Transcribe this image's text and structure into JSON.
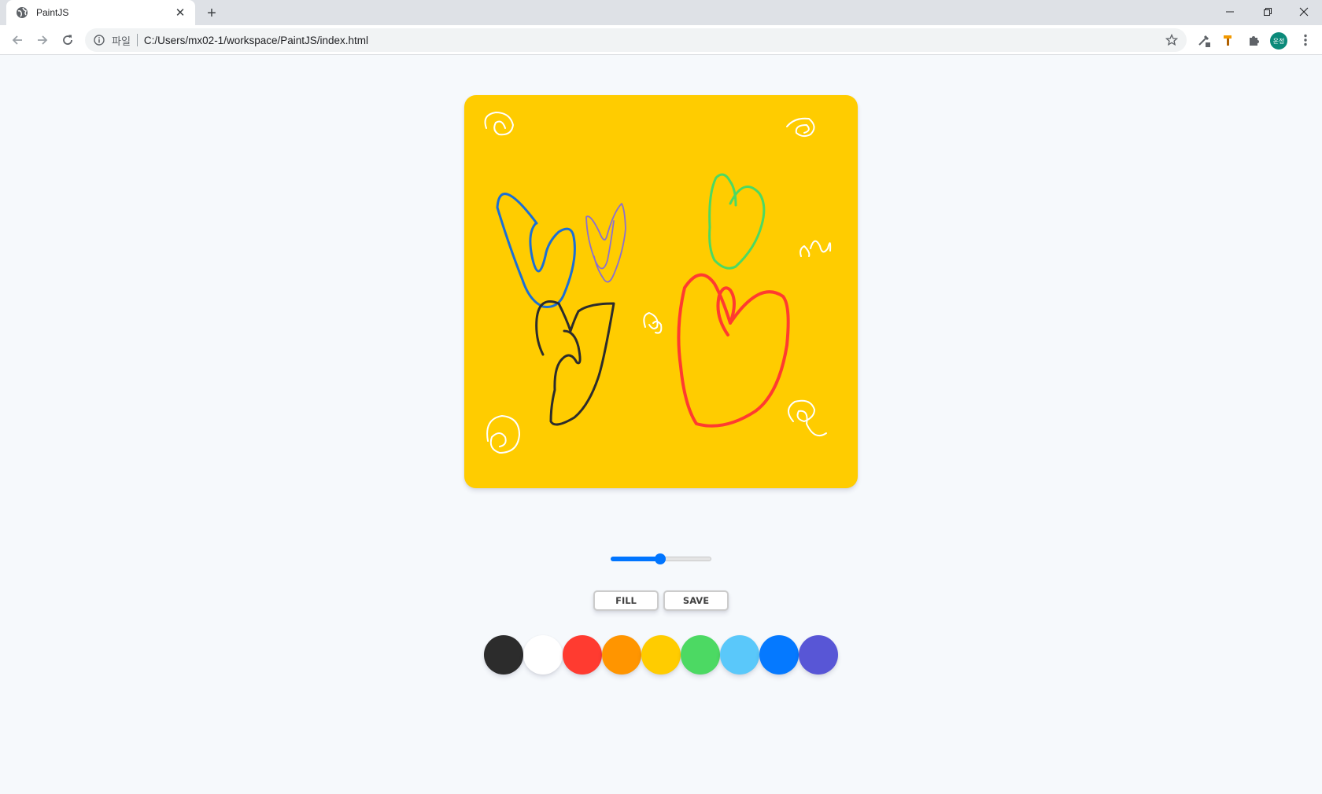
{
  "browser": {
    "tab": {
      "title": "PaintJS",
      "favicon_icon": "globe-icon",
      "close_icon": "close-icon"
    },
    "new_tab_icon": "plus-icon",
    "window_controls": [
      "minimize-icon",
      "restore-icon",
      "close-icon"
    ],
    "nav": {
      "back_icon": "arrow-left-icon",
      "forward_icon": "arrow-right-icon",
      "reload_icon": "reload-icon"
    },
    "address_bar": {
      "info_icon": "info-icon",
      "scheme_label": "파일",
      "url": "C:/Users/mx02-1/workspace/PaintJS/index.html",
      "bookmark_icon": "star-icon"
    },
    "extensions": [
      "eyedropper-icon",
      "hammer-icon",
      "puzzle-icon"
    ],
    "profile": {
      "initials": "운정",
      "color": "#0b8a7a"
    },
    "menu_icon": "kebab-menu-icon"
  },
  "canvas": {
    "background": "#ffcc00"
  },
  "brush_size": {
    "min": 0.1,
    "max": 5.0,
    "value": 2.5,
    "accent": "#0075ff"
  },
  "controls": {
    "fill_label": "FILL",
    "save_label": "SAVE"
  },
  "palette": [
    {
      "name": "black",
      "hex": "#2c2c2c"
    },
    {
      "name": "white",
      "hex": "#ffffff"
    },
    {
      "name": "red",
      "hex": "#ff3b30"
    },
    {
      "name": "orange",
      "hex": "#ff9500"
    },
    {
      "name": "yellow",
      "hex": "#ffcc00"
    },
    {
      "name": "green",
      "hex": "#4cd963"
    },
    {
      "name": "sky",
      "hex": "#5ac8fa"
    },
    {
      "name": "blue",
      "hex": "#0579ff"
    },
    {
      "name": "purple",
      "hex": "#5856d6"
    }
  ]
}
